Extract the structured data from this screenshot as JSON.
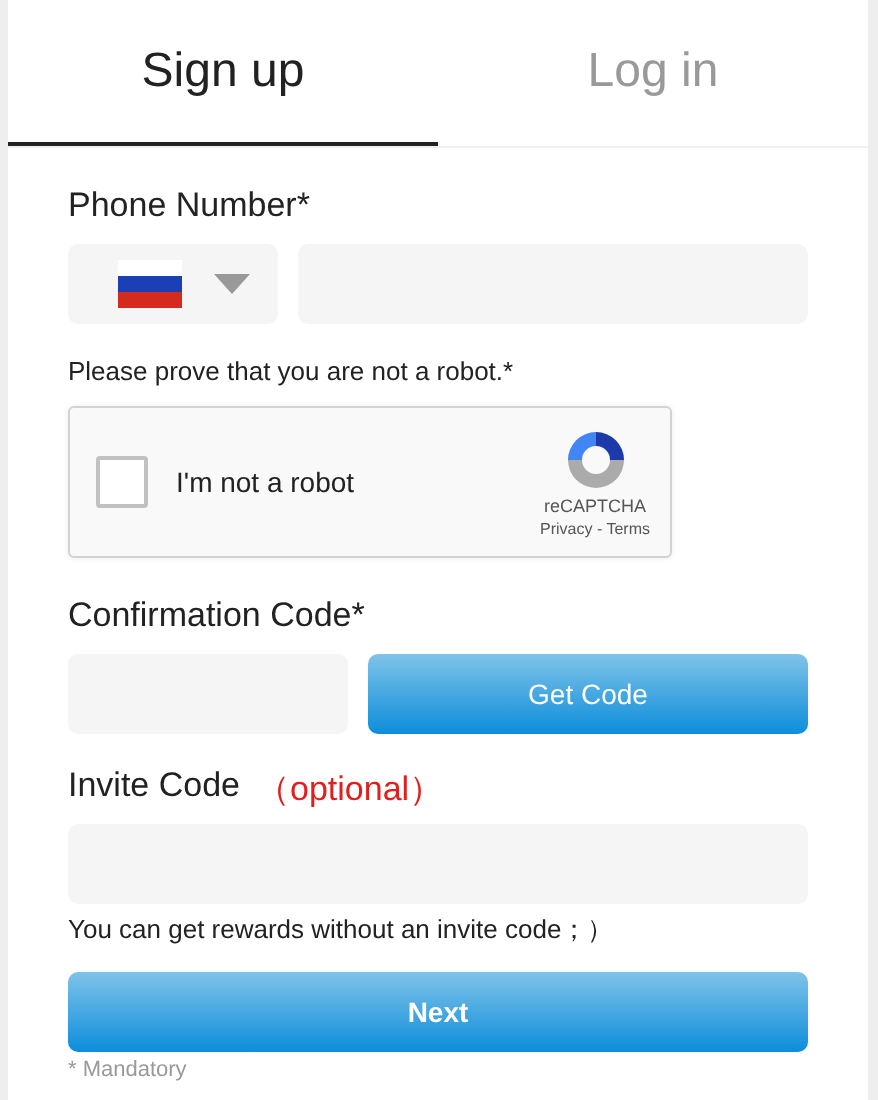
{
  "tabs": [
    {
      "label": "Sign up",
      "selected": true
    },
    {
      "label": "Log in",
      "selected": false
    }
  ],
  "phone": {
    "label": "Phone Number*"
  },
  "robot_prompt": "Please prove that you are not a robot.*",
  "captcha": {
    "checked": false,
    "label": "I'm not a robot",
    "brand": "reCAPTCHA",
    "links": "Privacy - Terms"
  },
  "confirmation": {
    "label": "Confirmation Code*",
    "button": "Get Code"
  },
  "invite": {
    "label": "Invite Code",
    "optional": "（optional）",
    "hint": "You can get rewards without an invite code；）"
  },
  "next_button": "Next",
  "footnote": "* Mandatory"
}
